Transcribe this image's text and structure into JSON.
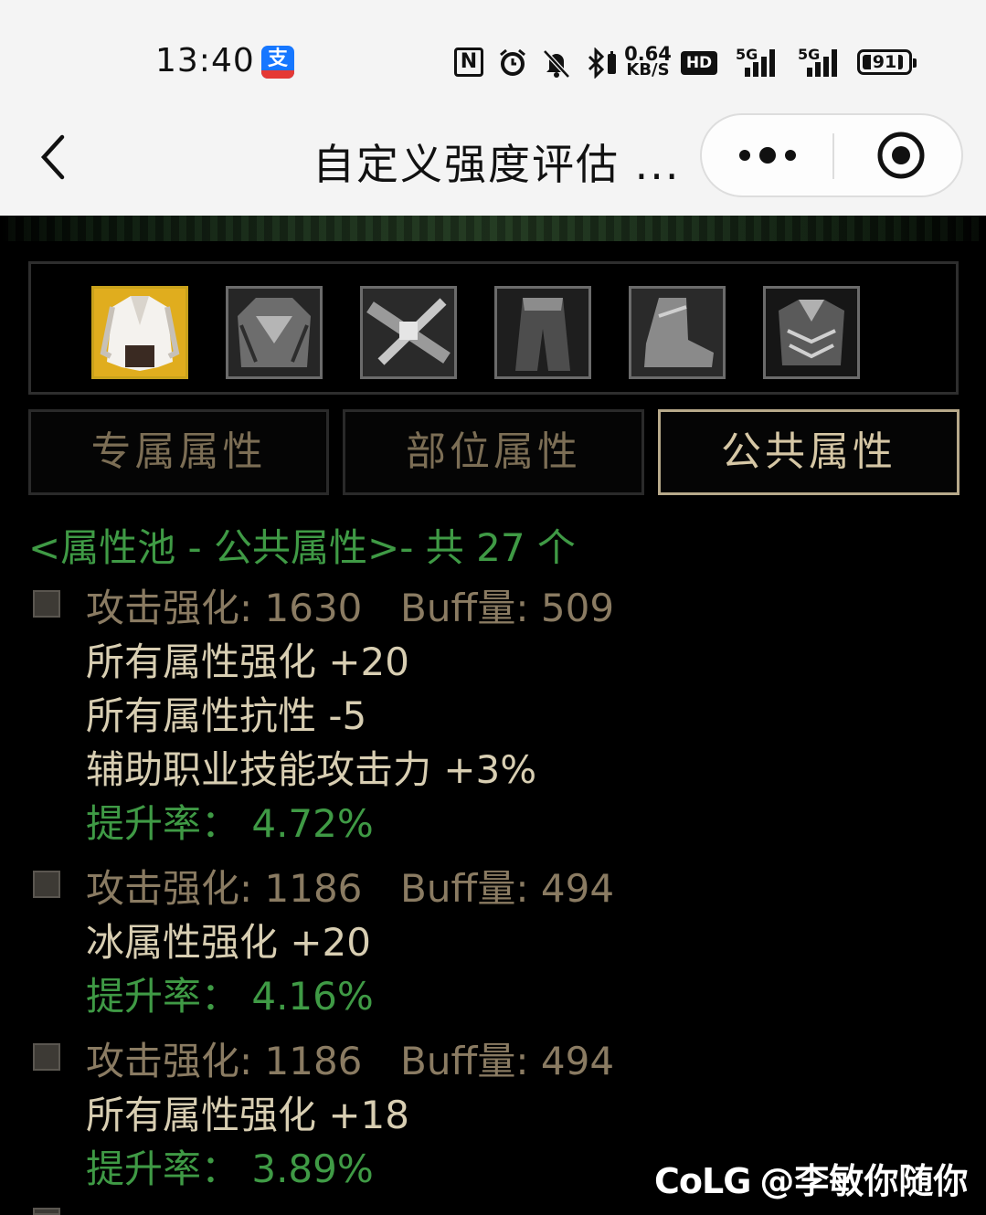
{
  "status_bar": {
    "time": "13:40",
    "alipay_glyph": "支",
    "nfc_glyph": "N",
    "net_speed_value": "0.64",
    "net_speed_unit": "KB/S",
    "hd_badge": "HD",
    "signal_1_label": "5G",
    "signal_2_label": "5G",
    "battery_level": "91",
    "icons": [
      "alipay-icon",
      "nfc-icon",
      "alarm-icon",
      "mute-icon",
      "bluetooth-icon",
      "hd-icon",
      "signal-icon",
      "battery-icon"
    ]
  },
  "titlebar": {
    "title": "自定义强度评估 ..."
  },
  "equipment_slots": [
    {
      "name": "上衣",
      "selected": true
    },
    {
      "name": "头肩",
      "selected": false
    },
    {
      "name": "腰带",
      "selected": false
    },
    {
      "name": "下装",
      "selected": false
    },
    {
      "name": "鞋",
      "selected": false
    },
    {
      "name": "护甲",
      "selected": false
    }
  ],
  "tabs": [
    {
      "label": "专属属性",
      "selected": false
    },
    {
      "label": "部位属性",
      "selected": false
    },
    {
      "label": "公共属性",
      "selected": true
    }
  ],
  "pool": {
    "header": "<属性池 - 公共属性>- 共 27 个",
    "entries": [
      {
        "attack": "攻击强化: 1630",
        "buff": "Buff量: 509",
        "attributes": [
          "所有属性强化 +20",
          "所有属性抗性 -5",
          "辅助职业技能攻击力 +3%"
        ],
        "rate": "提升率：  4.72%"
      },
      {
        "attack": "攻击强化: 1186",
        "buff": "Buff量: 494",
        "attributes": [
          "冰属性强化 +20"
        ],
        "rate": "提升率：  4.16%"
      },
      {
        "attack": "攻击强化: 1186",
        "buff": "Buff量: 494",
        "attributes": [
          "所有属性强化 +18"
        ],
        "rate": "提升率：  3.89%"
      }
    ]
  },
  "watermark": {
    "logo": "CoLG",
    "user": "@李敏你随你"
  },
  "colors": {
    "green_text": "#3f9a45",
    "stat_text": "#8a7b62",
    "attr_text": "#d8ceb2",
    "selected_tab_border": "#b7a98a",
    "selected_slot": "#e3b21b"
  }
}
